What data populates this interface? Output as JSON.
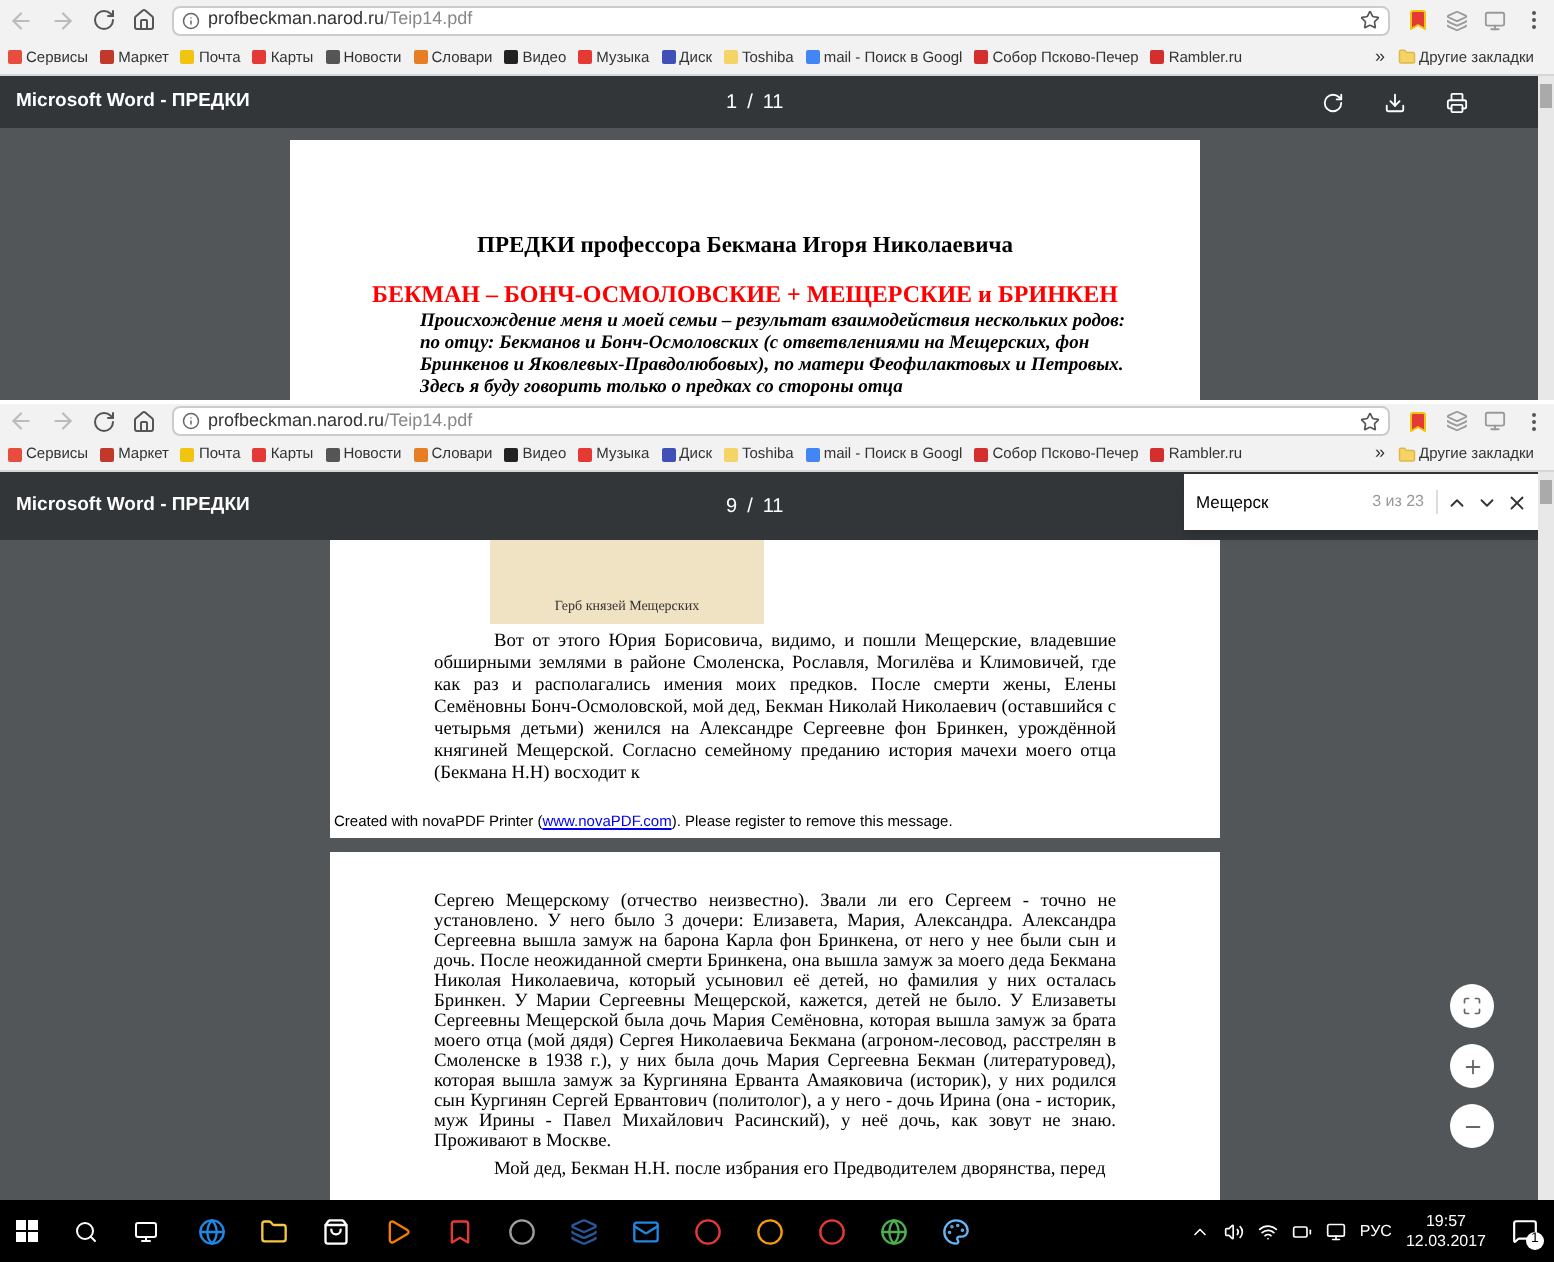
{
  "windows": [
    {
      "address": {
        "host": "profbeckman.narod.ru",
        "path": "/Teip14.pdf"
      },
      "bookmarks": [
        "Сервисы",
        "Маркет",
        "Почта",
        "Карты",
        "Новости",
        "Словари",
        "Видео",
        "Музыка",
        "Диск",
        "Toshiba",
        "mail - Поиск в Googl",
        "Собор Псково-Печер",
        "Rambler.ru"
      ],
      "more": "»",
      "other_bookmarks": "Другие закладки",
      "pdf_toolbar": {
        "title": "Microsoft Word - ПРЕДКИ",
        "page": "1",
        "separator": "/",
        "total": "11"
      },
      "pages": [
        {
          "blocks": [
            {
              "kind": "heading",
              "text": "ПРЕДКИ профессора Бекмана Игоря Николаевича"
            },
            {
              "kind": "red_heading",
              "text": "БЕКМАН – БОНЧ-ОСМОЛОВСКИЕ + МЕЩЕРСКИЕ и БРИНКЕН"
            },
            {
              "kind": "lines",
              "lines": [
                "Происхождение меня и моей семьи – результат взаимодействия нескольких родов:",
                "по отцу: Бекманов и Бонч-Осмоловских (с ответвлениями на Мещерских, фон",
                "Бринкенов и Яковлевых-Правдолюбовых), по матери Феофилактовых и Петровых.",
                "Здесь я буду говорить только о предках со стороны отца"
              ]
            }
          ]
        }
      ]
    },
    {
      "address": {
        "host": "profbeckman.narod.ru",
        "path": "/Teip14.pdf"
      },
      "bookmarks": [
        "Сервисы",
        "Маркет",
        "Почта",
        "Карты",
        "Новости",
        "Словари",
        "Видео",
        "Музыка",
        "Диск",
        "Toshiba",
        "mail - Поиск в Googl",
        "Собор Псково-Печер",
        "Rambler.ru"
      ],
      "more": "»",
      "other_bookmarks": "Другие закладки",
      "pdf_toolbar": {
        "title": "Microsoft Word - ПРЕДКИ",
        "page": "9",
        "separator": "/",
        "total": "11"
      },
      "find": {
        "query": "Мещерск",
        "count": "3 из 23"
      },
      "pages": [
        {
          "blocks": [
            {
              "kind": "figure",
              "caption": "Герб князей Мещерских"
            },
            {
              "kind": "paragraph",
              "text": "Вот от этого Юрия Борисовича, видимо, и пошли Мещерские, владевшие обширными землями в районе Смоленска, Рославля, Могилёва и Климовичей, где как раз и располагались имения моих предков. После смерти жены, Елены Семёновны Бонч-Осмоловской, мой дед, Бекман Николай Николаевич (оставшийся с четырьмя детьми) женился на Александре Сергеевне фон Бринкен, урождённой княгиней Мещерской. Согласно семейному преданию история мачехи моего отца (Бекмана Н.Н) восходит к"
            },
            {
              "kind": "footer",
              "before": "Created with novaPDF Printer (",
              "link": "www.novaPDF.com",
              "after": "). Please register to remove this message."
            }
          ]
        },
        {
          "blocks": [
            {
              "kind": "paragraph_plain",
              "text": "Сергею Мещерскому (отчество неизвестно). Звали ли его Сергеем - точно не установлено. У него было 3 дочери: Елизавета, Мария, Александра. Александра Сергеевна вышла замуж на барона Карла фон Бринкена, от него у нее были сын и дочь. После неожиданной смерти Бринкена, она вышла замуж за моего деда Бекмана Николая Николаевича, который усыновил её детей, но фамилия у них осталась Бринкен. У Марии Сергеевны Мещерской, кажется, детей не было. У Елизаветы Сергеевны Мещерской была дочь Мария Семёновна, которая вышла замуж за брата моего отца (мой дядя) Сергея Николаевича Бекмана (агроном-лесовод, расстрелян в Смоленске в 1938 г.), у них была дочь Мария Сергеевна Бекман (литературовед), которая вышла замуж за Кургиняна Ерванта Амаяковича (историк), у них родился сын Кургинян Сергей Ервантович (политолог), а у него - дочь Ирина (она - историк, муж Ирины - Павел Михайлович Расинский), у неё дочь, как зовут не знаю. Проживают в Москве."
            },
            {
              "kind": "paragraph",
              "text": "Мой дед, Бекман Н.Н. после избрания его Предводителем дворянства, перед"
            }
          ]
        }
      ]
    }
  ],
  "taskbar": {
    "language": "РУС",
    "time": "19:57",
    "date": "12.03.2017",
    "notifications": "1"
  }
}
